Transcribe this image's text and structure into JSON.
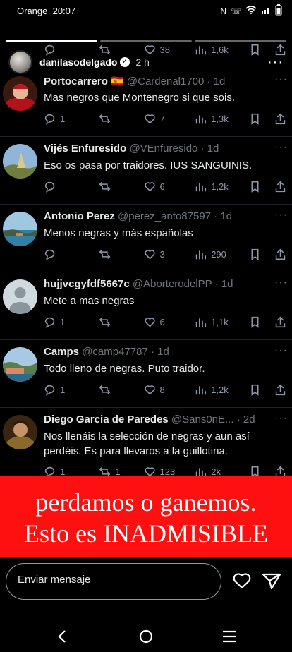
{
  "status": {
    "carrier": "Orange",
    "time": "20:07",
    "battery": ""
  },
  "story": {
    "username": "danilasodelgado",
    "time": "2 h",
    "more": "···"
  },
  "top_actions": {
    "reply": "",
    "rt": "",
    "likes": "38",
    "views": "1,6k"
  },
  "tweets": [
    {
      "name": "Portocarrero 🇪🇸",
      "handle": "@Cardenal1700 · 1d",
      "text": "Mas negros que Montenegro si que sois.",
      "replies": "1",
      "rts": "",
      "likes": "7",
      "views": "1,3k"
    },
    {
      "name": "Vijés Enfuresido",
      "handle": "@VEnfuresido · 1d",
      "text": "Eso os pasa por traidores. IUS SANGUINIS.",
      "replies": "",
      "rts": "",
      "likes": "6",
      "views": "1,2k"
    },
    {
      "name": "Antonio Perez",
      "handle": "@perez_anto87597 · 1d",
      "text": "Menos negras y más españolas",
      "replies": "",
      "rts": "",
      "likes": "3",
      "views": "290"
    },
    {
      "name": "hujjvcgyfdf5667c",
      "handle": "@AborterodelPP · 1d",
      "text": "Mete a mas negras",
      "replies": "1",
      "rts": "",
      "likes": "6",
      "views": "1,1k"
    },
    {
      "name": "Camps",
      "handle": "@camp47787 · 1d",
      "text": "Todo lleno de negras. Puto traidor.",
      "replies": "1",
      "rts": "",
      "likes": "8",
      "views": "1,2k"
    },
    {
      "name": "Diego Garcia de Paredes",
      "handle": "@Sans0nE... · 2d",
      "text": "Nos llenáis la selección de negras y aun así perdéis. Es para llevaros a la guillotina.",
      "replies": "1",
      "rts": "1",
      "likes": "123",
      "views": "2k"
    }
  ],
  "caption": {
    "line1": "perdamos o ganemos.",
    "line2": "Esto es INADMISIBLE"
  },
  "composer": {
    "placeholder": "Enviar mensaje"
  },
  "colors": {
    "background": "#000000",
    "caption_bg": "#ff1010",
    "muted": "#71767b"
  }
}
